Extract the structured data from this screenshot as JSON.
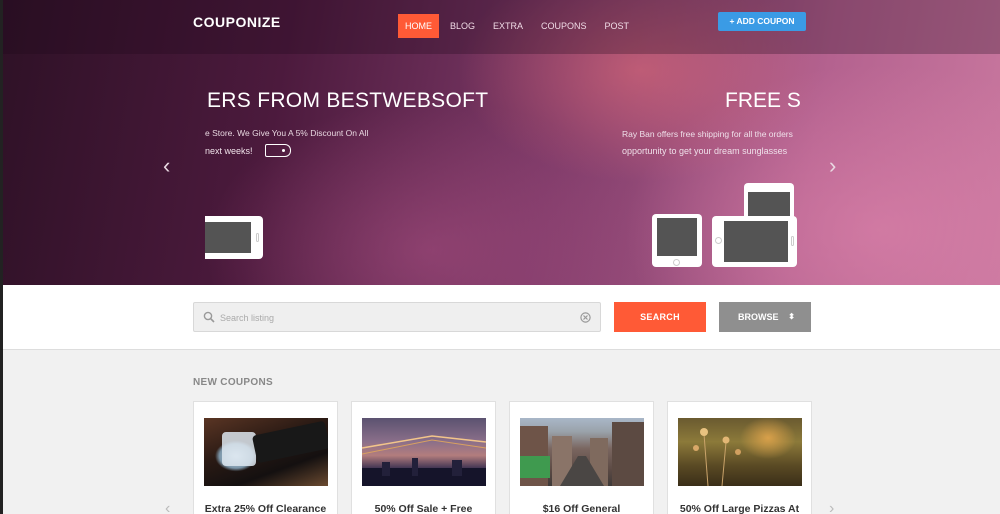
{
  "header": {
    "logo": "COUPONIZE",
    "nav": [
      {
        "label": "HOME",
        "active": true
      },
      {
        "label": "BLOG",
        "active": false
      },
      {
        "label": "EXTRA",
        "active": false
      },
      {
        "label": "COUPONS",
        "active": false
      },
      {
        "label": "POST",
        "active": false
      }
    ],
    "add_coupon_label": "+ ADD COUPON"
  },
  "slider": {
    "left": {
      "title": "ERS FROM BESTWEBSOFT",
      "text_line1": "e Store. We Give You A 5% Discount On All",
      "text_line2": "next weeks!"
    },
    "right": {
      "title": "FREE SHIPPING",
      "text_line1": "Ray Ban offers free shipping for all the orders",
      "text_line2": "opportunity to get your dream sunglasses"
    },
    "prev_icon": "chevron-left-icon",
    "next_icon": "chevron-right-icon"
  },
  "search": {
    "placeholder": "Search listing",
    "search_label": "SEARCH",
    "browse_label": "BROWSE",
    "browse_caret": "⬍"
  },
  "coupons": {
    "section_title": "NEW COUPONS",
    "items": [
      {
        "title": "Extra 25% Off Clearance",
        "image": "smartwatch-photo"
      },
      {
        "title": "50% Off Sale + Free",
        "image": "bridge-night-photo"
      },
      {
        "title": "$16 Off General",
        "image": "city-street-photo"
      },
      {
        "title": "50% Off Large Pizzas At",
        "image": "wildflowers-photo"
      }
    ]
  },
  "colors": {
    "accent": "#ff5a36",
    "add_coupon": "#3a9be5",
    "browse": "#8f8f8f"
  }
}
